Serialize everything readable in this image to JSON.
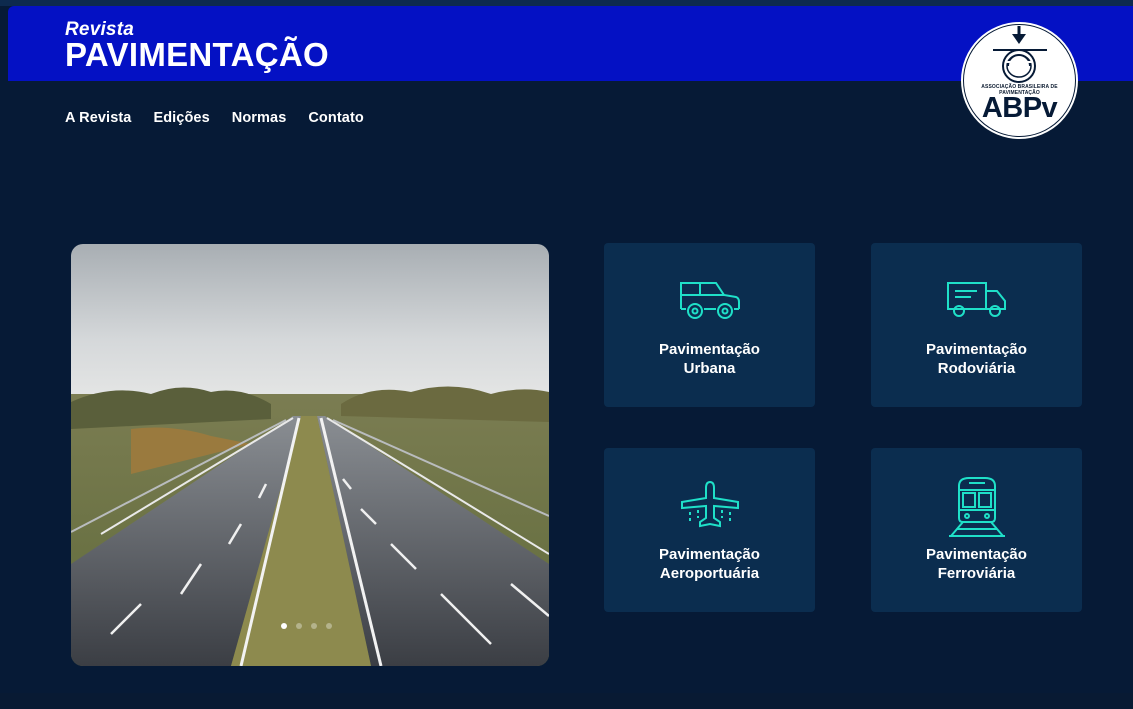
{
  "header": {
    "brand_small": "Revista",
    "brand_big": "PAVIMENTAÇÃO",
    "logo_tagline": "ASSOCIAÇÃO BRASILEIRA DE PAVIMENTAÇÃO",
    "logo_word": "ABPv"
  },
  "nav": {
    "items": [
      {
        "label": "A Revista"
      },
      {
        "label": "Edições"
      },
      {
        "label": "Normas"
      },
      {
        "label": "Contato"
      }
    ]
  },
  "carousel": {
    "slide_count": 4,
    "active_index": 0
  },
  "cards": [
    {
      "line1": "Pavimentação",
      "line2": "Urbana",
      "icon": "car-icon"
    },
    {
      "line1": "Pavimentação",
      "line2": "Rodoviária",
      "icon": "truck-icon"
    },
    {
      "line1": "Pavimentação",
      "line2": "Aeroportuária",
      "icon": "airplane-icon"
    },
    {
      "line1": "Pavimentação",
      "line2": "Ferroviária",
      "icon": "train-icon"
    }
  ],
  "colors": {
    "brand_blue": "#0411c4",
    "background": "#061a36",
    "card_bg": "#0b2d4f",
    "icon_accent": "#1fe0c8"
  }
}
